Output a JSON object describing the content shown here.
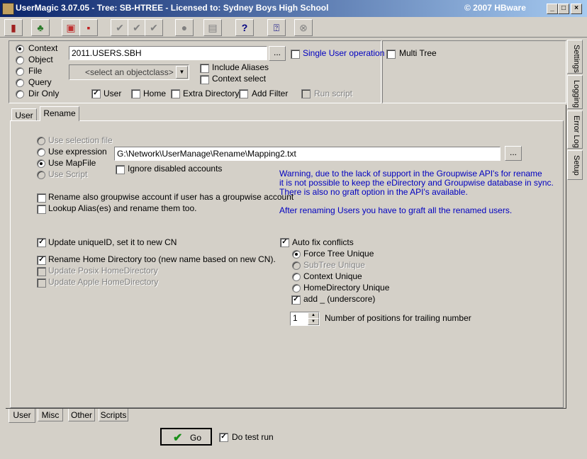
{
  "window": {
    "title": "UserMagic 3.07.05 - Tree: SB-HTREE - Licensed to: Sydney Boys High School",
    "copyright": "© 2007 HBware"
  },
  "toolbar": {
    "help_label": "?"
  },
  "source": {
    "modes": [
      "Context",
      "Object",
      "File",
      "Query",
      "Dir Only"
    ],
    "selected_mode": "Context",
    "context_value": "2011.USERS.SBH",
    "browse_label": "...",
    "objectclass_placeholder": "<select an objectclass>",
    "single_user_label": "Single User operation",
    "include_aliases_label": "Include Aliases",
    "context_select_label": "Context select",
    "multi_tree_label": "Multi Tree",
    "options": {
      "user": "User",
      "home": "Home",
      "extra_directory": "Extra Directory",
      "add_filter": "Add Filter",
      "run_script": "Run script"
    }
  },
  "side_tabs": [
    "Settings",
    "Logging",
    "Error Log",
    "Setup"
  ],
  "inner_tabs": [
    "User",
    "Rename"
  ],
  "active_inner_tab": "Rename",
  "rename": {
    "use_selection_file": "Use selection file",
    "use_expression": "Use expression",
    "use_mapfile": "Use MapFile",
    "use_script": "Use Script",
    "mapfile_path": "G:\\Network\\UserManage\\Rename\\Mapping2.txt",
    "browse_label": "...",
    "ignore_disabled": "Ignore disabled accounts",
    "warning_line1": "Warning, due to the lack of support in the  Groupwise API's for rename",
    "warning_line2": "it is not possible to keep the eDirectory and Groupwise database in sync.",
    "warning_line3": "There is also no graft option in the API's available.",
    "after_rename_note": "After renaming Users you have to graft all the renamed users.",
    "rename_groupwise": "Rename also groupwise account if user has a groupwise account",
    "lookup_alias": "Lookup Alias(es) and rename them too.",
    "update_uniqueid": "Update uniqueID, set it to new CN",
    "rename_home": "Rename Home Directory too (new name based on new CN).",
    "update_posix": "Update Posix HomeDirectory",
    "update_apple": "Update Apple HomeDirectory",
    "auto_fix": "Auto fix conflicts",
    "force_tree_unique": "Force Tree Unique",
    "subtree_unique": "SubTree Unique",
    "context_unique": "Context Unique",
    "homedir_unique": "HomeDirectory Unique",
    "add_underscore": "add _ (underscore)",
    "positions_value": "1",
    "positions_label": "Number of positions for trailing number"
  },
  "bottom_tabs": [
    "User",
    "Misc",
    "Other",
    "Scripts"
  ],
  "active_bottom_tab": "User",
  "go_label": "Go",
  "test_run_label": "Do test run"
}
